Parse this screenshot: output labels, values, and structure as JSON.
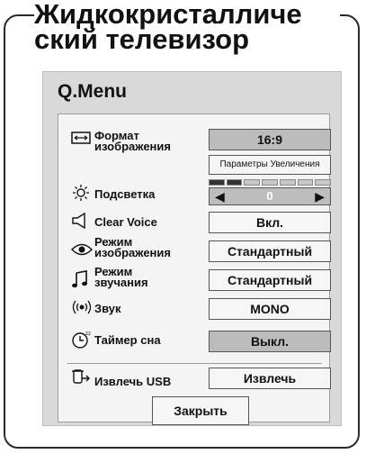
{
  "manual": {
    "title_line1": "Жидкокристалличе",
    "title_line2": "ский телевизор"
  },
  "qmenu": {
    "title": "Q.Menu",
    "items": [
      {
        "label": "Формат\nизображения",
        "value": "16:9",
        "sub_value": "Параметры Увеличения",
        "icon": "aspect-ratio-icon"
      },
      {
        "label": "Подсветка",
        "value": "0",
        "icon": "backlight-icon"
      },
      {
        "label": "Clear Voice",
        "value": "Вкл.",
        "icon": "speaker-icon"
      },
      {
        "label": "Режим\nизображения",
        "value": "Стандартный",
        "icon": "eye-icon"
      },
      {
        "label": "Режим\nзвучания",
        "value": "Стандартный",
        "icon": "music-note-icon"
      },
      {
        "label": "Звук",
        "value": "MONO",
        "icon": "sound-waves-icon"
      },
      {
        "label": "Таймер сна",
        "value": "Выкл.",
        "icon": "sleep-timer-icon"
      },
      {
        "label": "Извлечь USB",
        "value": "Извлечь",
        "icon": "usb-eject-icon"
      }
    ],
    "backlight_level": 0,
    "close_label": "Закрыть"
  },
  "colors": {
    "screen_bg": "#d9d9d9",
    "panel_bg": "#f4f4f4",
    "selected_bg": "#bcbcbc"
  }
}
